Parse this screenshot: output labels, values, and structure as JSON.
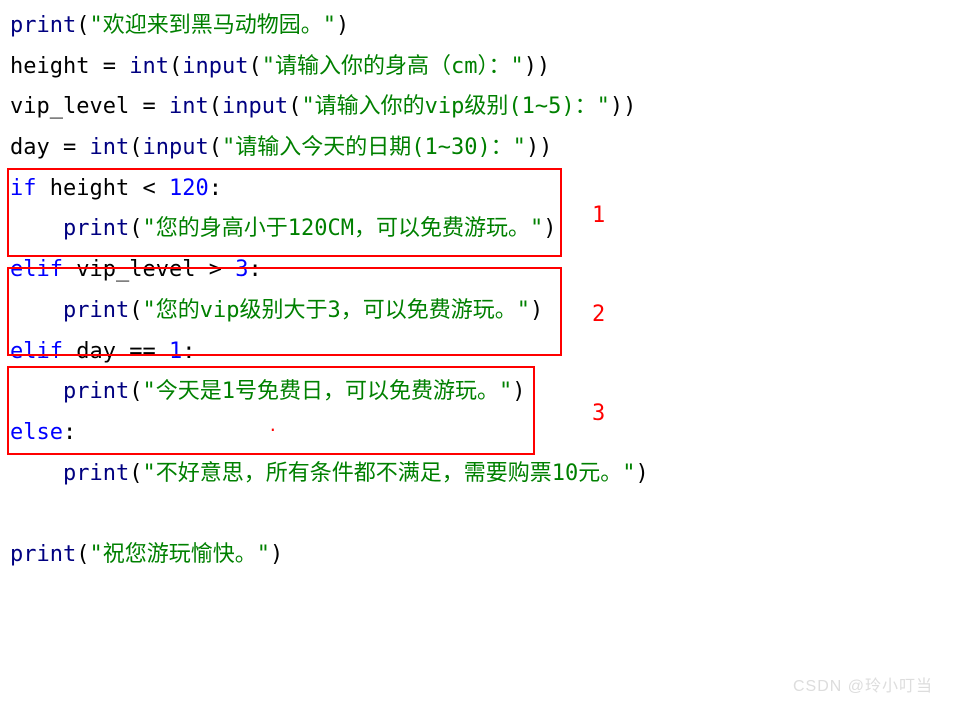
{
  "lines": {
    "l1": {
      "p1": "print",
      "s1": "(",
      "s2": "\"欢迎来到黑马动物园。\"",
      "s3": ")"
    },
    "l2": {
      "t1": "height ",
      "op1": "=",
      "s1": " ",
      "f1": "int",
      "s2": "(",
      "f2": "input",
      "s3": "(",
      "str1": "\"请输入你的身高（cm）：\"",
      "s4": "))"
    },
    "l3": {
      "t1": "vip_level ",
      "op1": "=",
      "s1": " ",
      "f1": "int",
      "s2": "(",
      "f2": "input",
      "s3": "(",
      "str1": "\"请输入你的vip级别(1~5)：\"",
      "s4": "))"
    },
    "l4": {
      "t1": "day ",
      "op1": "=",
      "s1": " ",
      "f1": "int",
      "s2": "(",
      "f2": "input",
      "s3": "(",
      "str1": "\"请输入今天的日期(1~30)：\"",
      "s4": "))"
    },
    "l5": {
      "k1": "if",
      "t1": " height ",
      "op1": "<",
      "s1": " ",
      "n1": "120",
      "t2": ":"
    },
    "l6": {
      "indent": "    ",
      "f1": "print",
      "s1": "(",
      "str1": "\"您的身高小于120CM，可以免费游玩。\"",
      "s2": ")"
    },
    "l7": {
      "k1": "elif",
      "t1": " vip_level ",
      "op1": ">",
      "s1": " ",
      "n1": "3",
      "t2": ":"
    },
    "l8": {
      "indent": "    ",
      "f1": "print",
      "s1": "(",
      "str1": "\"您的vip级别大于3，可以免费游玩。\"",
      "s2": ")"
    },
    "l9": {
      "k1": "elif",
      "t1": " day ",
      "op1": "==",
      "s1": " ",
      "n1": "1",
      "t2": ":"
    },
    "l10": {
      "indent": "    ",
      "f1": "print",
      "s1": "(",
      "str1": "\"今天是1号免费日，可以免费游玩。\"",
      "s2": ")"
    },
    "l11": {
      "k1": "else",
      "t1": ":"
    },
    "l12": {
      "indent": "    ",
      "f1": "print",
      "s1": "(",
      "str1": "\"不好意思，所有条件都不满足，需要购票10元。\"",
      "s2": ")"
    },
    "l13": {
      "empty": " "
    },
    "l14": {
      "f1": "print",
      "s1": "(",
      "str1": "\"祝您游玩愉快。\"",
      "s2": ")"
    }
  },
  "annotations": {
    "a1": "1",
    "a2": "2",
    "a3": "3"
  },
  "watermark": "CSDN @玲小叮当"
}
